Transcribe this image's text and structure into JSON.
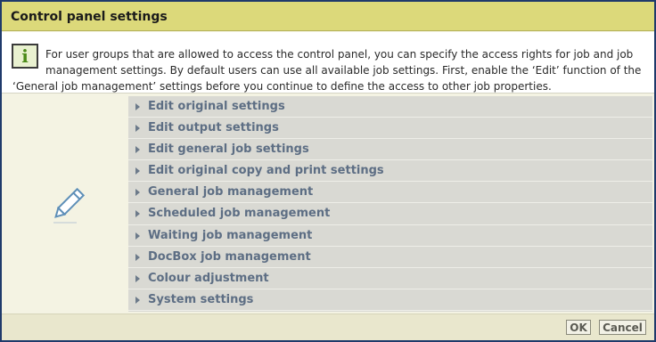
{
  "dialog": {
    "title": "Control panel settings",
    "info": {
      "icon": "info-icon",
      "line1": "For user groups that are allowed to access the control panel, you can specify the access rights for job and job",
      "line2": "management settings. By default users can use all available job settings. First, enable the ‘Edit’ function of the",
      "line3": "‘General job management’ settings before you continue to define the access to other job properties."
    },
    "left_icon": "pencil-icon",
    "items": [
      {
        "label": "Edit original settings"
      },
      {
        "label": "Edit output settings"
      },
      {
        "label": "Edit general job settings"
      },
      {
        "label": "Edit original copy and print settings"
      },
      {
        "label": "General job management"
      },
      {
        "label": "Scheduled job management"
      },
      {
        "label": "Waiting job management"
      },
      {
        "label": "DocBox job management"
      },
      {
        "label": "Colour adjustment"
      },
      {
        "label": "System settings"
      }
    ],
    "buttons": {
      "ok": "OK",
      "cancel": "Cancel"
    }
  }
}
